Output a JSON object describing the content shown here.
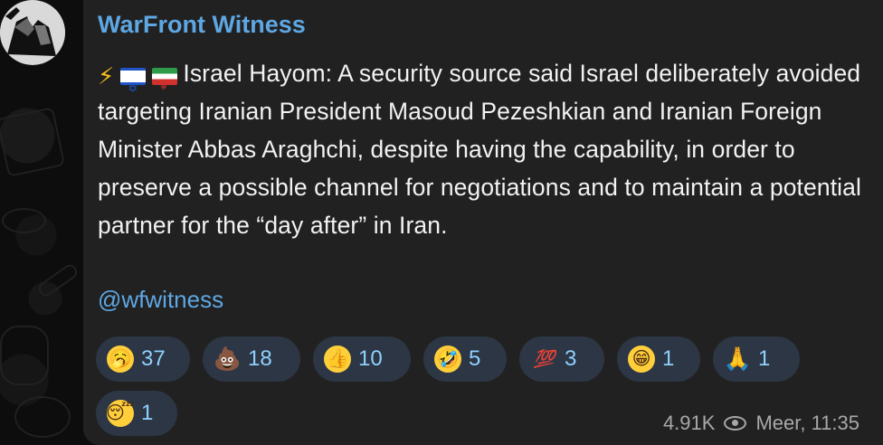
{
  "channel": {
    "name": "WarFront Witness",
    "handle": "@wfwitness"
  },
  "message": {
    "lead_icons": [
      "lightning-icon",
      "israel-flag-icon",
      "iran-flag-icon"
    ],
    "text": "Israel Hayom: A security source said Israel deliberately avoided targeting Iranian President Masoud Pezeshkian and Iranian Foreign Minister Abbas Araghchi, despite having the capability, in order to preserve a possible channel for negotiations and to maintain a potential partner for the “day after” in Iran."
  },
  "reactions": [
    {
      "icon": "yawning-face-icon",
      "glyph": "🥱",
      "count": "37"
    },
    {
      "icon": "pile-of-poo-icon",
      "glyph": "💩",
      "count": "18"
    },
    {
      "icon": "thumbs-up-icon",
      "glyph": "👍",
      "count": "10"
    },
    {
      "icon": "rolling-laughing-icon",
      "glyph": "🤣",
      "count": "5"
    },
    {
      "icon": "hundred-points-icon",
      "glyph": "💯",
      "count": "3"
    },
    {
      "icon": "grinning-face-icon",
      "glyph": "😁",
      "count": "1"
    },
    {
      "icon": "praying-hands-icon",
      "glyph": "🙏",
      "count": "1"
    },
    {
      "icon": "sleeping-face-icon",
      "glyph": "😴",
      "count": "1"
    }
  ],
  "footer": {
    "views": "4.91K",
    "view_icon": "eye-icon",
    "time": "Meer, 11:35"
  },
  "colors": {
    "background": "#0e0e0e",
    "bubble": "#212121",
    "accent": "#5ea7e3",
    "reaction_pill": "#2d3644",
    "meta_text": "#a8a8a8"
  }
}
